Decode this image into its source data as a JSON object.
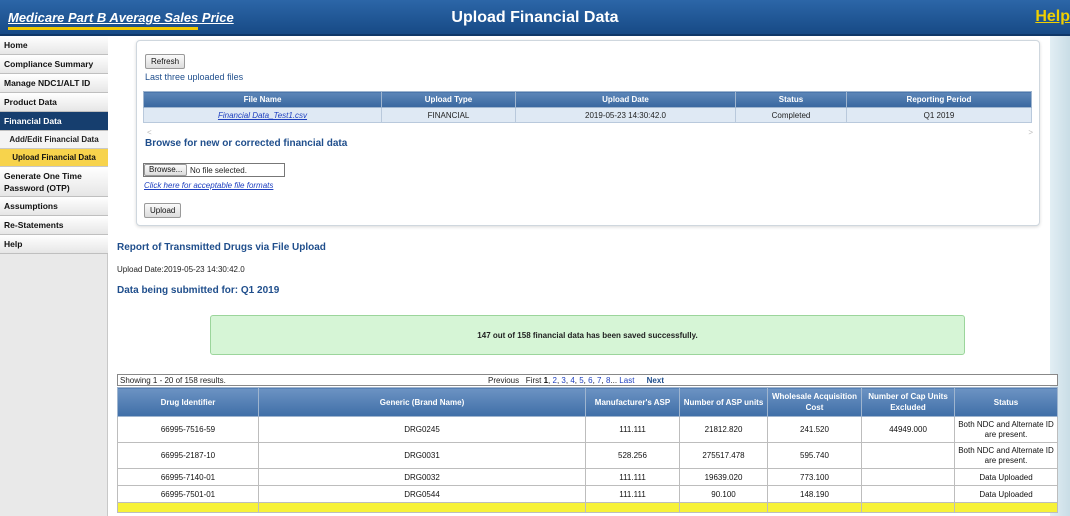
{
  "header": {
    "brand": "Medicare Part B Average Sales Price",
    "title": "Upload Financial Data",
    "help": "Help"
  },
  "sidebar": {
    "items": [
      {
        "label": "Home"
      },
      {
        "label": "Compliance Summary"
      },
      {
        "label": "Manage NDC1/ALT ID"
      },
      {
        "label": "Product Data"
      },
      {
        "label": "Financial Data"
      },
      {
        "label": "Add/Edit Financial Data"
      },
      {
        "label": "Upload Financial Data"
      },
      {
        "label": "Generate One Time Password (OTP)"
      },
      {
        "label": "Assumptions"
      },
      {
        "label": "Re-Statements"
      },
      {
        "label": "Help"
      }
    ]
  },
  "upload_panel": {
    "refresh_label": "Refresh",
    "last_files_label": "Last three uploaded files",
    "columns": [
      "File Name",
      "Upload Type",
      "Upload Date",
      "Status",
      "Reporting Period"
    ],
    "rows": [
      {
        "file_name": "Financial Data_Test1.csv",
        "upload_type": "FINANCIAL",
        "upload_date": "2019-05-23 14:30:42.0",
        "status": "Completed",
        "period": "Q1 2019"
      }
    ],
    "scroll_left": "<",
    "scroll_right": ">",
    "browse_title": "Browse for new or corrected financial data",
    "browse_label": "Browse...",
    "no_file": "No file selected.",
    "formats_link": "Click here for acceptable file formats",
    "upload_label": "Upload"
  },
  "report": {
    "title": "Report of Transmitted Drugs via File Upload",
    "upload_date": "Upload Date:2019-05-23 14:30:42.0",
    "submitted_for": "Data being submitted for: Q1 2019",
    "success_message": "147 out of 158 financial data has been saved successfully."
  },
  "pager": {
    "results": "Showing 1 - 20 of 158 results.",
    "previous": "Previous",
    "first": "First",
    "current": "1",
    "pages": [
      "2",
      "3",
      "4",
      "5",
      "6",
      "7",
      "8"
    ],
    "ellipsis": "...",
    "last": "Last",
    "next": "Next"
  },
  "drug_table": {
    "columns": [
      "Drug Identifier",
      "Generic (Brand Name)",
      "Manufacturer's ASP",
      "Number of ASP units",
      "Wholesale Acquisition Cost",
      "Number of Cap Units Excluded",
      "Status"
    ],
    "rows": [
      {
        "id": "66995-7516-59",
        "generic": "DRG0245",
        "asp": "111.111",
        "units": "21812.820",
        "wac": "241.520",
        "cap": "44949.000",
        "status": "Both NDC and Alternate ID are present."
      },
      {
        "id": "66995-2187-10",
        "generic": "DRG0031",
        "asp": "528.256",
        "units": "275517.478",
        "wac": "595.740",
        "cap": "",
        "status": "Both NDC and Alternate ID are present."
      },
      {
        "id": "66995-7140-01",
        "generic": "DRG0032",
        "asp": "111.111",
        "units": "19639.020",
        "wac": "773.100",
        "cap": "",
        "status": "Data Uploaded"
      },
      {
        "id": "66995-7501-01",
        "generic": "DRG0544",
        "asp": "111.111",
        "units": "90.100",
        "wac": "148.190",
        "cap": "",
        "status": "Data Uploaded"
      }
    ]
  }
}
